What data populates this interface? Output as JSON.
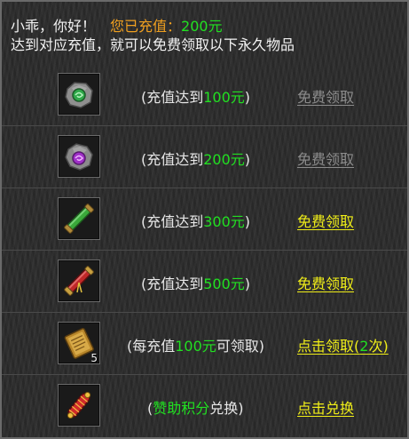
{
  "header": {
    "greeting": "小乖，你好！",
    "charged_label": "您已充值：",
    "charged_amount": "200元",
    "subtitle": "达到对应充值，就可以免费领取以下永久物品"
  },
  "rows": [
    {
      "icon": "gray-stone-green-gem-icon",
      "prefix": "(充值达到",
      "amount": "100元",
      "suffix": ")",
      "action": "免费领取",
      "state": "claimed"
    },
    {
      "icon": "gray-stone-purple-gem-icon",
      "prefix": "(充值达到",
      "amount": "200元",
      "suffix": ")",
      "action": "免费领取",
      "state": "claimed"
    },
    {
      "icon": "green-scroll-icon",
      "prefix": "(充值达到",
      "amount": "300元",
      "suffix": ")",
      "action": "免费领取",
      "state": "available"
    },
    {
      "icon": "red-scroll-icon",
      "prefix": "(充值达到",
      "amount": "500元",
      "suffix": ")",
      "action": "免费领取",
      "state": "available"
    },
    {
      "icon": "golden-book-icon",
      "quantity": "5",
      "prefix": "(每充值",
      "amount": "100元",
      "suffix": "可领取)",
      "action": "点击领取",
      "action_count_open": "(",
      "action_count": "2",
      "action_count_close": "次)",
      "state": "available"
    },
    {
      "icon": "red-firecracker-scroll-icon",
      "prefix": "(",
      "amount": "赞助积分",
      "suffix": "兑换)",
      "action": "点击兑换",
      "state": "available"
    }
  ],
  "colors": {
    "highlight_green": "#21e021",
    "charged_orange": "#f0a020",
    "action_yellow": "#f0ee18",
    "disabled_gray": "#8c8c8c"
  }
}
